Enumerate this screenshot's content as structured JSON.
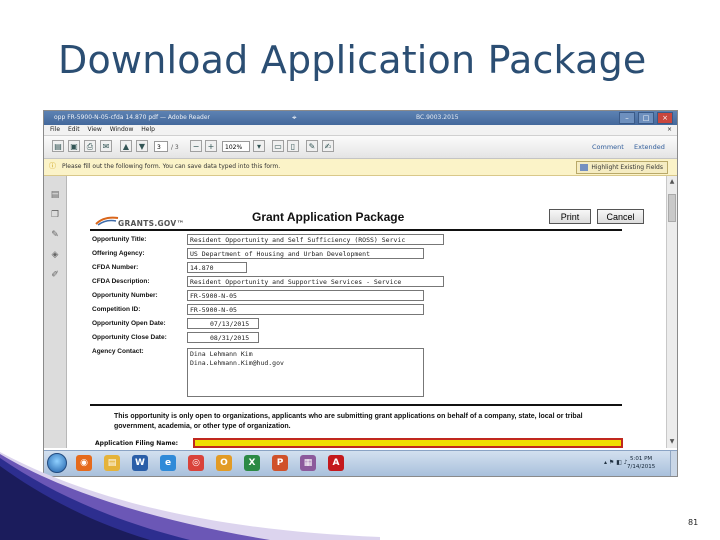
{
  "slide": {
    "title": "Download Application Package",
    "page_number": "81"
  },
  "window": {
    "title": "opp FR-5900-N-05-cfda 14.870 pdf — Adobe Reader",
    "center_text": "BC.9003.2015",
    "menu": [
      "File",
      "Edit",
      "View",
      "Window",
      "Help"
    ],
    "close_menu_label": "×"
  },
  "toolbar": {
    "page_current": "3",
    "page_total": "/ 3",
    "zoom": "102%",
    "comment_label": "Comment",
    "extended_label": "Extended"
  },
  "infobar": {
    "message": "Please fill out the following form. You can save data typed into this form.",
    "highlight_button": "Highlight Existing Fields"
  },
  "form": {
    "logo_text": "GRANTS.GOV™",
    "heading": "Grant Application Package",
    "print_label": "Print",
    "cancel_label": "Cancel",
    "fields": [
      {
        "label": "Opportunity Title:",
        "value": "Resident Opportunity and Self Sufficiency (ROSS) Servic"
      },
      {
        "label": "Offering Agency:",
        "value": "US Department of Housing and Urban Development"
      },
      {
        "label": "CFDA Number:",
        "value": "14.870"
      },
      {
        "label": "CFDA Description:",
        "value": "Resident Opportunity and Supportive Services - Service"
      },
      {
        "label": "Opportunity Number:",
        "value": "FR-5900-N-05"
      },
      {
        "label": "Competition ID:",
        "value": "FR-5900-N-05"
      },
      {
        "label": "Opportunity Open Date:",
        "value": "07/13/2015"
      },
      {
        "label": "Opportunity Close Date:",
        "value": "08/31/2015"
      }
    ],
    "agency_contact_label": "Agency Contact:",
    "agency_contact_lines": [
      "Dina Lehmann Kim",
      "Dina.Lehmann.Kim@hud.gov"
    ],
    "notice": "This opportunity is only open to organizations, applicants who are submitting grant applications on behalf of a company, state, local or tribal government, academia, or other type of organization.",
    "partial_label": "Application Filing Name:"
  },
  "taskbar": {
    "apps": [
      {
        "icon": "firefox-icon",
        "color": "#e56a1c",
        "glyph": "◉"
      },
      {
        "icon": "folder-icon",
        "color": "#e5b33a",
        "glyph": "▤"
      },
      {
        "icon": "word-icon",
        "color": "#2a5ea8",
        "glyph": "W"
      },
      {
        "icon": "internet-explorer-icon",
        "color": "#2f8ad8",
        "glyph": "e"
      },
      {
        "icon": "chrome-icon",
        "color": "#d9423a",
        "glyph": "◎"
      },
      {
        "icon": "outlook-icon",
        "color": "#e29b25",
        "glyph": "O"
      },
      {
        "icon": "excel-icon",
        "color": "#2c8a44",
        "glyph": "X"
      },
      {
        "icon": "powerpoint-icon",
        "color": "#d0512a",
        "glyph": "P"
      },
      {
        "icon": "archive-icon",
        "color": "#8c5a9c",
        "glyph": "▦"
      },
      {
        "icon": "adobe-reader-icon",
        "color": "#c4181c",
        "glyph": "A"
      }
    ],
    "time": "5:01 PM",
    "date": "7/14/2015"
  }
}
